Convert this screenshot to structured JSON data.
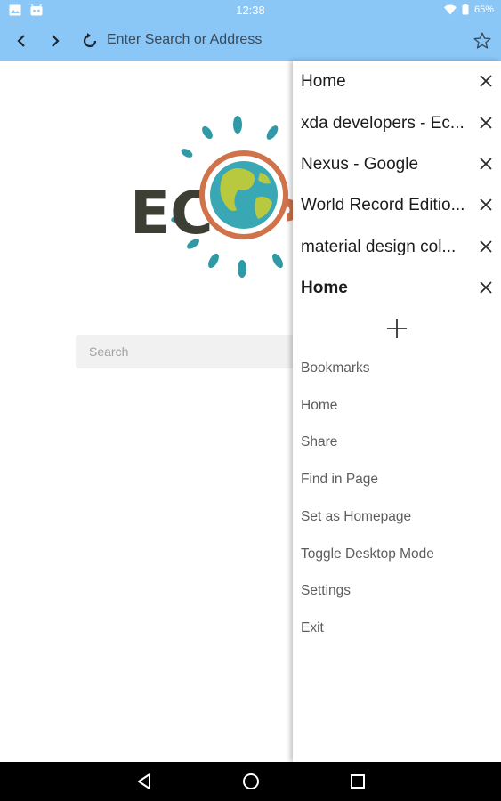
{
  "status_bar": {
    "time": "12:38",
    "battery": "65%",
    "icons": [
      "image-icon",
      "android-icon",
      "wifi-icon",
      "battery-icon"
    ]
  },
  "toolbar": {
    "back_icon": "chevron-left-icon",
    "forward_icon": "chevron-right-icon",
    "refresh_icon": "refresh-icon",
    "address_placeholder": "Enter Search or Address",
    "bookmark_icon": "star-outline-icon"
  },
  "page": {
    "logo_text": "ECO",
    "search_placeholder": "Search"
  },
  "drawer": {
    "tabs": [
      {
        "title": "Home",
        "active": false
      },
      {
        "title": "xda developers - Ec...",
        "active": false
      },
      {
        "title": "Nexus - Google",
        "active": false
      },
      {
        "title": "World Record Editio...",
        "active": false
      },
      {
        "title": "material design col...",
        "active": false
      },
      {
        "title": "Home",
        "active": true
      }
    ],
    "add_tab_icon": "plus-icon",
    "menu": [
      "Bookmarks",
      "Home",
      "Share",
      "Find in Page",
      "Set as Homepage",
      "Toggle Desktop Mode",
      "Settings",
      "Exit"
    ]
  },
  "nav_bar": {
    "icons": [
      "back-triangle-icon",
      "home-circle-icon",
      "recents-square-icon"
    ]
  },
  "colors": {
    "toolbar": "#8ac6f6",
    "logo_text": "#3d3f35",
    "logo_ring": "#d0734b",
    "logo_ocean": "#3aa7b4",
    "logo_land": "#b9c93f",
    "logo_rays": "#2f9aa6"
  }
}
